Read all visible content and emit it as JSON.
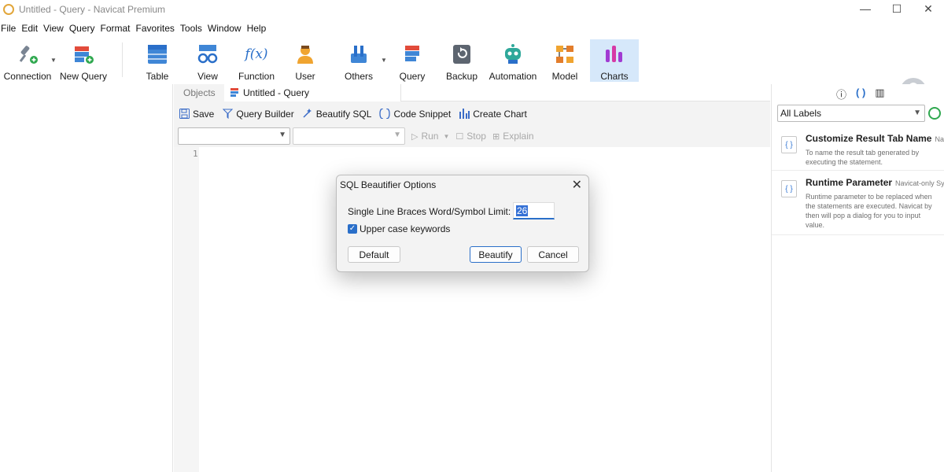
{
  "window": {
    "title": "Untitled - Query - Navicat Premium",
    "controls": [
      "—",
      "☐",
      "✕"
    ]
  },
  "menu": [
    "File",
    "Edit",
    "View",
    "Query",
    "Format",
    "Favorites",
    "Tools",
    "Window",
    "Help"
  ],
  "toolbar": {
    "connection": "Connection",
    "new_query": "New Query",
    "table": "Table",
    "view": "View",
    "function": "Function",
    "user": "User",
    "others": "Others",
    "query": "Query",
    "backup": "Backup",
    "automation": "Automation",
    "model": "Model",
    "charts": "Charts",
    "function_glyph": "f(x)"
  },
  "tabs": {
    "objects": "Objects",
    "query": "Untitled - Query"
  },
  "query_toolbar": {
    "save": "Save",
    "query_builder": "Query Builder",
    "beautify_sql": "Beautify SQL",
    "code_snippet": "Code Snippet",
    "create_chart": "Create Chart"
  },
  "run_bar": {
    "run": "Run",
    "stop": "Stop",
    "explain": "Explain"
  },
  "editor": {
    "line_numbers": [
      "1"
    ]
  },
  "right_pane": {
    "labels_select": "All Labels",
    "snippets": [
      {
        "title": "Customize Result Tab Name",
        "subtitle": "Navi",
        "description": "To name the result tab generated by executing the statement."
      },
      {
        "title": "Runtime Parameter",
        "subtitle": "Navicat-only Syn",
        "description": "Runtime parameter to be replaced when the statements are executed. Navicat by then will pop a dialog for you to input value."
      }
    ]
  },
  "dialog": {
    "title": "SQL Beautifier Options",
    "limit_label": "Single Line Braces Word/Symbol Limit:",
    "limit_value": "26",
    "upper_case_label": "Upper case keywords",
    "upper_case_checked": true,
    "default_button": "Default",
    "beautify_button": "Beautify",
    "cancel_button": "Cancel"
  },
  "colors": {
    "accent": "#2a6fc9",
    "charts_active_bg": "#d6e8fa"
  }
}
